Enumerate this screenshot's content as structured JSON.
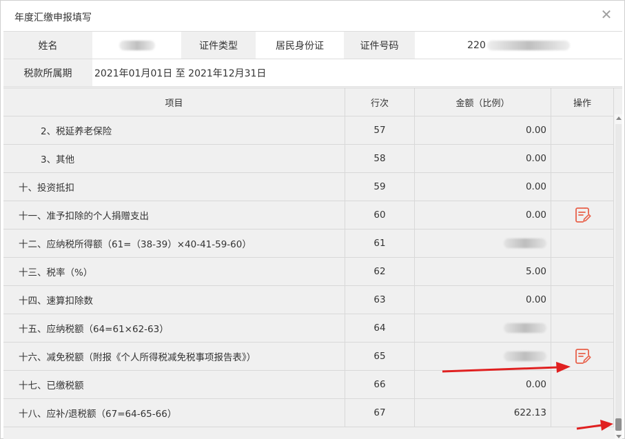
{
  "dialog": {
    "title": "年度汇缴申报填写"
  },
  "info": {
    "name_label": "姓名",
    "id_type_label": "证件类型",
    "id_type_value": "居民身份证",
    "id_number_label": "证件号码",
    "id_number_prefix": "220",
    "period_label": "税款所属期",
    "period_value": "2021年01月01日 至 2021年12月31日"
  },
  "table": {
    "headers": {
      "item": "项目",
      "row": "行次",
      "amount": "金额（比例）",
      "action": "操作"
    },
    "rows": [
      {
        "item": "2、税延养老保险",
        "row": "57",
        "amount": "0.00",
        "sub": true,
        "editable": false,
        "hidden_amount": false
      },
      {
        "item": "3、其他",
        "row": "58",
        "amount": "0.00",
        "sub": true,
        "editable": false,
        "hidden_amount": false
      },
      {
        "item": "十、投资抵扣",
        "row": "59",
        "amount": "0.00",
        "sub": false,
        "editable": false,
        "hidden_amount": false
      },
      {
        "item": "十一、准予扣除的个人捐赠支出",
        "row": "60",
        "amount": "0.00",
        "sub": false,
        "editable": true,
        "hidden_amount": false
      },
      {
        "item": "十二、应纳税所得额（61=（38-39）×40-41-59-60）",
        "row": "61",
        "amount": "",
        "sub": false,
        "editable": false,
        "hidden_amount": true
      },
      {
        "item": "十三、税率（%）",
        "row": "62",
        "amount": "5.00",
        "sub": false,
        "editable": false,
        "hidden_amount": false
      },
      {
        "item": "十四、速算扣除数",
        "row": "63",
        "amount": "0.00",
        "sub": false,
        "editable": false,
        "hidden_amount": false
      },
      {
        "item": "十五、应纳税额（64=61×62-63）",
        "row": "64",
        "amount": "",
        "sub": false,
        "editable": false,
        "hidden_amount": true
      },
      {
        "item": "十六、减免税额（附报《个人所得税减免税事项报告表》）",
        "row": "65",
        "amount": "",
        "sub": false,
        "editable": true,
        "hidden_amount": true
      },
      {
        "item": "十七、已缴税额",
        "row": "66",
        "amount": "0.00",
        "sub": false,
        "editable": false,
        "hidden_amount": false
      },
      {
        "item": "十八、应补/退税额（67=64-65-66）",
        "row": "67",
        "amount": "622.13",
        "sub": false,
        "editable": false,
        "hidden_amount": false
      }
    ]
  },
  "icons": {
    "close": "close-icon",
    "edit": "edit-document-icon"
  },
  "colors": {
    "edit_icon": "#e8604a",
    "annotation_arrow": "#e02020",
    "header_bg": "#f0f0f0"
  }
}
